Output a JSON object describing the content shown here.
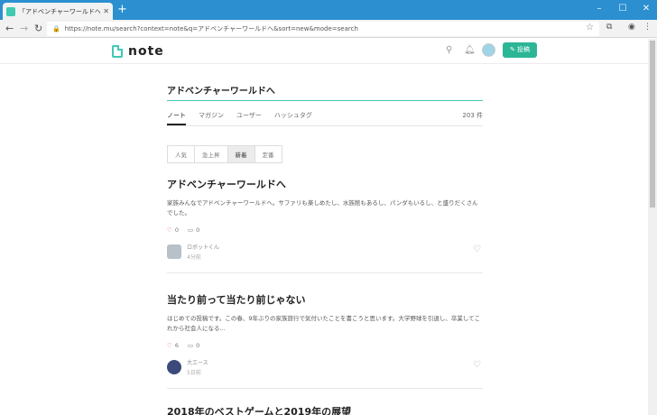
{
  "browser": {
    "tab_title": "「アドベンチャーワールドへ」の新着の",
    "url": "https://note.mu/search?context=note&q=アドベンチャーワールドへ&sort=new&mode=search"
  },
  "header": {
    "logo": "note",
    "post_label": "投稿"
  },
  "search": {
    "query": "アドベンチャーワールドへ",
    "tabs": [
      "ノート",
      "マガジン",
      "ユーザー",
      "ハッシュタグ"
    ],
    "count": "203 件",
    "sort": [
      "人気",
      "急上昇",
      "新着",
      "定番"
    ]
  },
  "articles": [
    {
      "title": "アドベンチャーワールドへ",
      "excerpt": "家族みんなでアドベンチャーワールドへ。サファリも楽しめたし、水族館もあるし、パンダもいるし、と盛りだくさんでした。",
      "likes": "0",
      "comments": "0",
      "author": "ロボットくん",
      "time": "4分前"
    },
    {
      "title": "当たり前って当たり前じゃない",
      "excerpt": "はじめての投稿です。この春、9年ぶりの家族旅行で気付いたことを書こうと思います。大学野球を引退し、卒業してこれから社会人になる...",
      "likes": "6",
      "comments": "0",
      "author": "大エース",
      "time": "5日前"
    },
    {
      "title": "2018年のベストゲームと2019年の展望"
    }
  ],
  "colors": {
    "accent": "#41c9b4",
    "post_button": "#2cb696",
    "titlebar": "#2b8fd0",
    "like_red": "#e25a5a"
  }
}
